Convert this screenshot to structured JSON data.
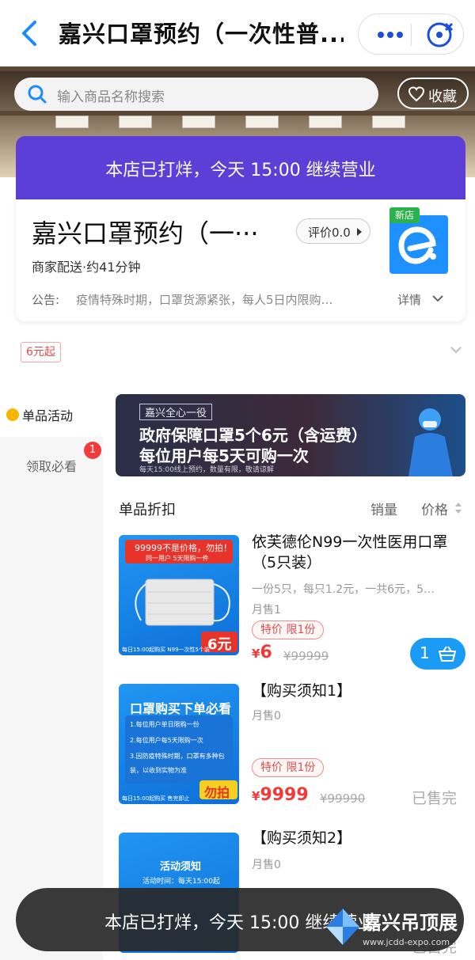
{
  "header": {
    "title": "嘉兴口罩预约（一次性普...",
    "more_icon": "more-dots-icon",
    "close_icon": "close-mini-program-icon"
  },
  "search": {
    "placeholder": "输入商品名称搜索",
    "favorite_label": "收藏"
  },
  "store": {
    "status_banner": "本店已打烊，今天 15:00 继续营业",
    "name": "嘉兴口罩预约（一···",
    "rating_label": "评价0.0",
    "new_badge": "新店",
    "delivery": "商家配送·约41分钟",
    "notice_label": "公告:",
    "notice_text": "疫情特殊时期，口罩货源紧张，每人5日内限购…",
    "detail_label": "详情",
    "min_order": "6元起",
    "accent_color": "#5b3fd6"
  },
  "sidebar": {
    "items": [
      {
        "label": "单品活动"
      },
      {
        "label": "领取必看",
        "badge": "1"
      }
    ]
  },
  "banner": {
    "tag": "嘉兴全心一役",
    "line1": "政府保障口罩5个6元（含运费）",
    "line2": "每位用户每5天可购一次",
    "line3": "每天15:00线上预约，数量有限，敬请谅解"
  },
  "list": {
    "title": "单品折扣",
    "sort_sales": "销量",
    "sort_price": "价格"
  },
  "products": [
    {
      "name": "依芙德伦N99一次性医用口罩（5只装）",
      "desc": "一份5只，每只1.2元，一共6元，5…",
      "sold": "月售1",
      "tag": "特价 限1份",
      "currency": "¥",
      "price": "6",
      "orig_price": "¥99999",
      "qty": "1",
      "img_top": "99999不是价格，勿拍！",
      "img_sub": "同一用户 5天限购一件",
      "img_price": "6元",
      "img_bottom": "每日15:00起购买    N99一次性5个装"
    },
    {
      "name": "【购买须知1】",
      "sold": "月售0",
      "tag": "特价 限1份",
      "currency": "¥",
      "price": "9999",
      "orig_price": "¥99990",
      "status": "已售完",
      "img_title": "口罩购买下单必看",
      "img_l1": "1.每位用户单日限购一份",
      "img_l2": "2.每位用户每5天限购一次",
      "img_l3": "3.因防疫特殊时期，口罩有多种包",
      "img_l4": "装，以收到实物为准",
      "img_stamp": "勿拍",
      "img_bottom": "每日15:00起购买    售完即止"
    },
    {
      "name": "【购买须知2】",
      "sold": "月售0",
      "status": "已售完",
      "img_title": "活动须知",
      "img_l1": "活动时间：每天15:00起"
    }
  ],
  "toast": {
    "text": "本店已打烊，今天 15:00 继续营业"
  },
  "watermark": {
    "name": "嘉兴吊顶展",
    "url": "www.jcdd-expo.com"
  }
}
